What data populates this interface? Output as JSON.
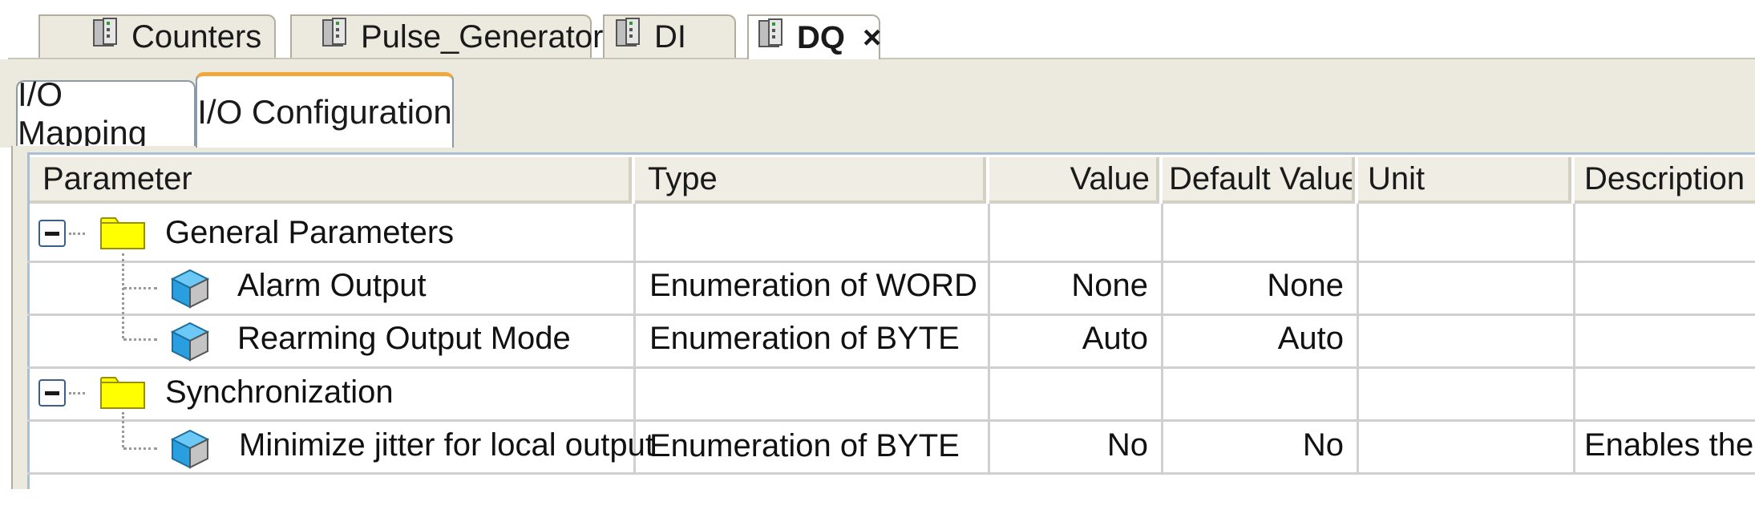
{
  "doc_tabs": [
    {
      "label": "Counters",
      "icon": "device-module-icon",
      "active": false
    },
    {
      "label": "Pulse_Generators",
      "icon": "device-module-icon",
      "active": false
    },
    {
      "label": "DI",
      "icon": "device-module-icon",
      "active": false
    },
    {
      "label": "DQ",
      "icon": "device-module-icon",
      "active": true,
      "close": "×"
    }
  ],
  "sub_tabs": [
    {
      "label": "I/O Mapping",
      "active": false
    },
    {
      "label": "I/O Configuration",
      "active": true
    }
  ],
  "columns": [
    "Parameter",
    "Type",
    "Value",
    "Default Value",
    "Unit",
    "Description"
  ],
  "rows": [
    {
      "kind": "group",
      "parameter": "General Parameters",
      "icon": "folder-icon",
      "expander": "collapse"
    },
    {
      "kind": "param",
      "parameter": "Alarm Output",
      "type": "Enumeration of WORD",
      "value": "None",
      "default": "None",
      "unit": "",
      "description": "",
      "icon": "parameter-cube-icon"
    },
    {
      "kind": "param",
      "parameter": "Rearming Output Mode",
      "type": "Enumeration of BYTE",
      "value": "Auto",
      "default": "Auto",
      "unit": "",
      "description": "",
      "icon": "parameter-cube-icon"
    },
    {
      "kind": "group",
      "parameter": "Synchronization",
      "icon": "folder-icon",
      "expander": "collapse"
    },
    {
      "kind": "param",
      "parameter": "Minimize jitter for local output",
      "type": "Enumeration of BYTE",
      "value": "No",
      "default": "No",
      "unit": "",
      "description": "Enables the",
      "icon": "parameter-cube-icon"
    }
  ],
  "colors": {
    "active_subtab_accent": "#f0a83a",
    "folder": "#ffff00",
    "parameter_cube": "#2a9fe0",
    "header_bg": "#f0ede4",
    "tab_strip_bg": "#ece9df"
  }
}
